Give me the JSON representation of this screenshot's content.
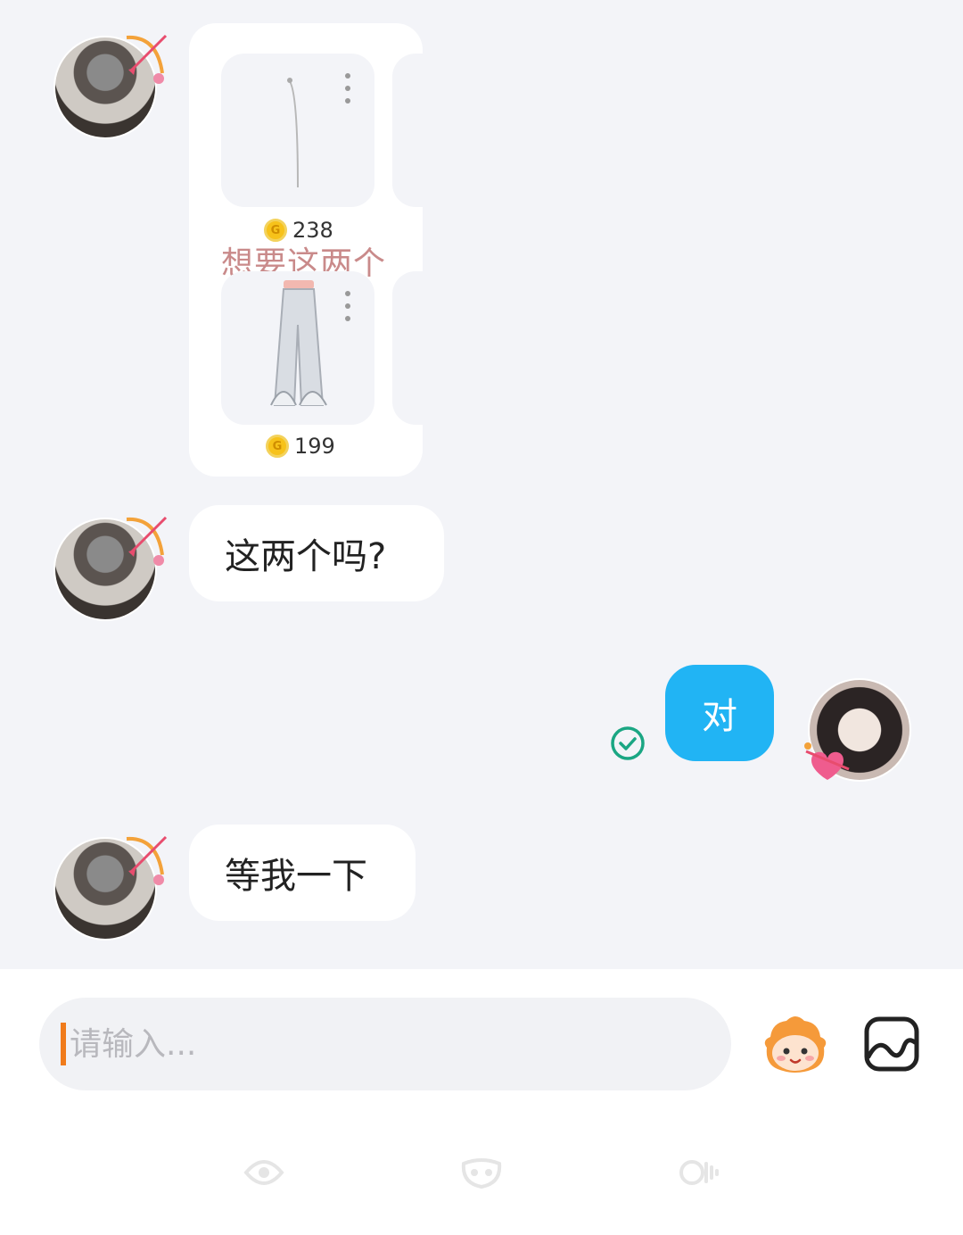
{
  "messages": {
    "product_card": {
      "items": [
        {
          "price": "238"
        },
        {
          "price": "199"
        }
      ],
      "caption": "想要这两个"
    },
    "msg_question": "这两个吗?",
    "msg_reply": "对",
    "msg_wait": "等我一下"
  },
  "composer": {
    "placeholder": "请输入..."
  },
  "icons": {
    "coin": "coin-icon",
    "sent_status": "check-circle-icon",
    "sticker": "sticker-face-icon",
    "image": "image-icon"
  },
  "colors": {
    "my_bubble": "#21b4f4",
    "cursor": "#f07b1b",
    "check": "#1aa683"
  }
}
